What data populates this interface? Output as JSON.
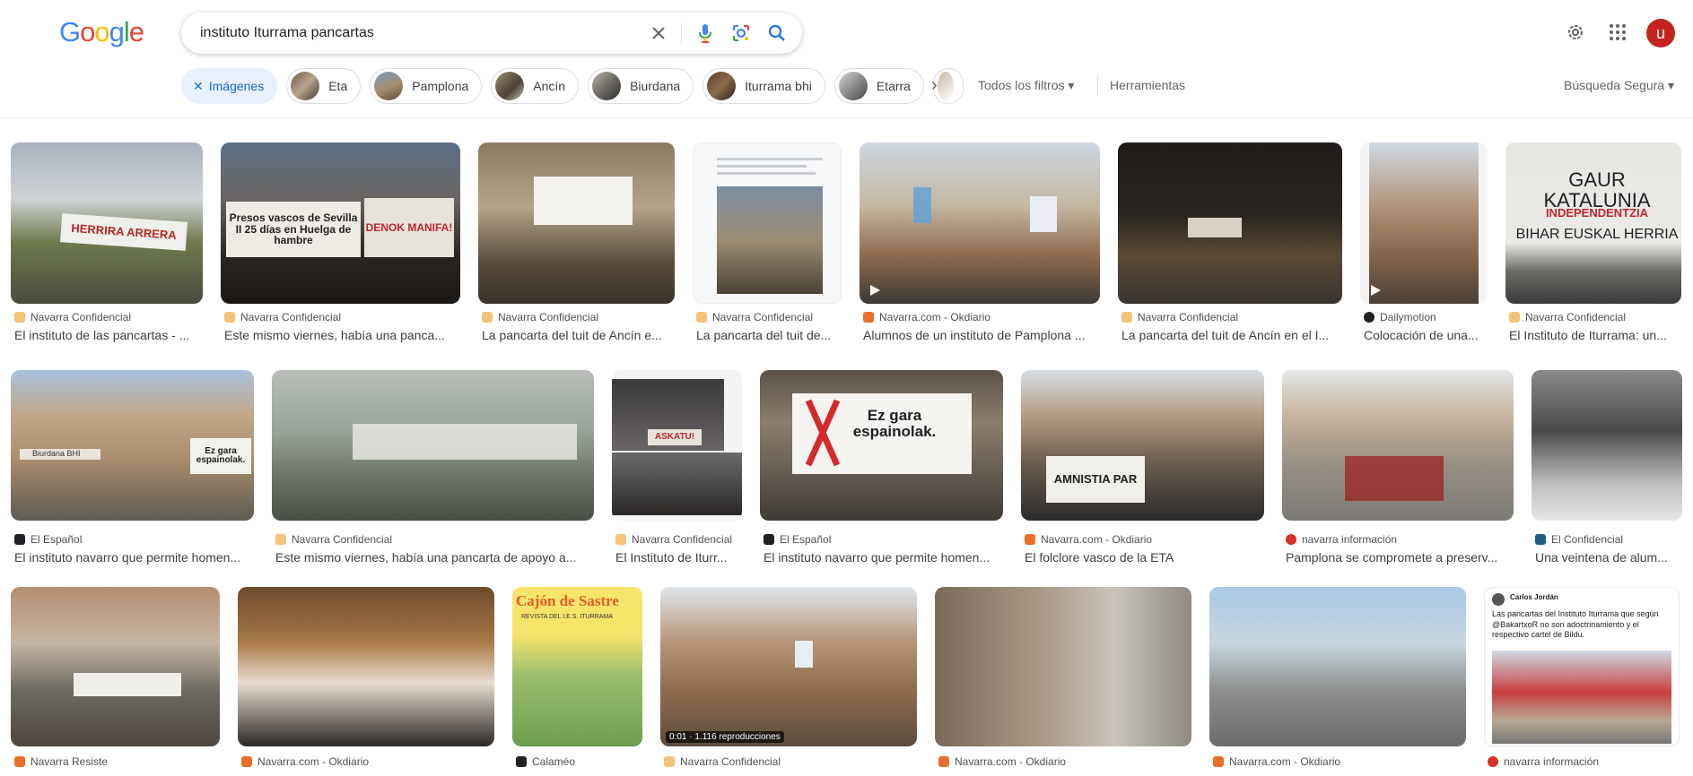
{
  "search": {
    "query": "instituto Iturrama pancartas"
  },
  "logo": {
    "letters": [
      "G",
      "o",
      "o",
      "g",
      "l",
      "e"
    ],
    "colors": [
      "#4285f4",
      "#ea4335",
      "#fbbc05",
      "#4285f4",
      "#34a853",
      "#ea4335"
    ]
  },
  "header": {
    "avatar_letter": "u"
  },
  "chips": {
    "active": "Imágenes",
    "items": [
      "Eta",
      "Pamplona",
      "Ancín",
      "Biurdana",
      "Iturrama bhi",
      "Etarra"
    ]
  },
  "toolbar": {
    "filters_label": "Todos los filtros",
    "tools_label": "Herramientas",
    "safesearch_label": "Búsqueda Segura"
  },
  "results": [
    {
      "source": "Navarra Confidencial",
      "title": "El instituto de las pancartas - ..."
    },
    {
      "source": "Navarra Confidencial",
      "title": "Este mismo viernes, había una panca..."
    },
    {
      "source": "Navarra Confidencial",
      "title": "La pancarta del tuit de Ancín e..."
    },
    {
      "source": "Navarra Confidencial",
      "title": "La pancarta del tuit de..."
    },
    {
      "source": "Navarra.com - Okdiario",
      "title": "Alumnos de un instituto de Pamplona ..."
    },
    {
      "source": "Navarra Confidencial",
      "title": "La pancarta del tuit de Ancín en el I..."
    },
    {
      "source": "Dailymotion",
      "title": "Colocación de una..."
    },
    {
      "source": "Navarra Confidencial",
      "title": "El Instituto de Iturrama: un..."
    },
    {
      "source": "El Español",
      "title": "El instituto navarro que permite homen..."
    },
    {
      "source": "Navarra Confidencial",
      "title": "Este mismo viernes, había una pancarta de apoyo a..."
    },
    {
      "source": "Navarra Confidencial",
      "title": "El Instituto de Iturr..."
    },
    {
      "source": "El Español",
      "title": "El instituto navarro que permite homen..."
    },
    {
      "source": "Navarra.com - Okdiario",
      "title": "El folclore vasco de la ETA"
    },
    {
      "source": "navarra información",
      "title": "Pamplona se compromete a preserv..."
    },
    {
      "source": "El Confidencial",
      "title": "Una veintena de alum..."
    },
    {
      "source": "Navarra Resiste",
      "title": ""
    },
    {
      "source": "Navarra.com - Okdiario",
      "title": ""
    },
    {
      "source": "Calaméo",
      "title": ""
    },
    {
      "source": "Navarra Confidencial",
      "title": ""
    },
    {
      "source": "Navarra.com - Okdiario",
      "title": ""
    },
    {
      "source": "Navarra.com - Okdiario",
      "title": ""
    },
    {
      "source": "navarra información",
      "title": ""
    }
  ],
  "image_text": {
    "r1_banner": "HERRIRA ARRERA",
    "r2_banner_left": "Presos vascos de Sevilla II 25 días en Huelga de hambre",
    "r2_banner_right": "DENOK MANIFA!",
    "r8_line1": "GAUR KATALUNIA",
    "r8_line2": "INDEPENDENTZIA",
    "r8_line3": "BIHAR EUSKAL HERRIA",
    "r9_sign": "Biurdana BHI",
    "r9_banner": "Ez gara espainolak.",
    "r11_banner": "ASKATU!",
    "r12_banner": "Ez gara espainolak.",
    "r13_banner": "AMNISTIA PAR",
    "r18_title": "Cajón de Sastre",
    "r18_sub": "REVISTA DEL I.E.S. ITURRAMA",
    "r19_duration": "0:01 · 1.116 reproducciones",
    "r22_user": "Carlos Jordán",
    "r22_tweet": "Las pancartas del Instituto Iturrama que según @BakartxoR no son adoctrinamiento y el respectivo cartel de Bildu."
  },
  "colors": {
    "accent_blue": "#1a73e8",
    "chip_active_bg": "#e8f0fe",
    "avatar_bg": "#c5221f"
  }
}
